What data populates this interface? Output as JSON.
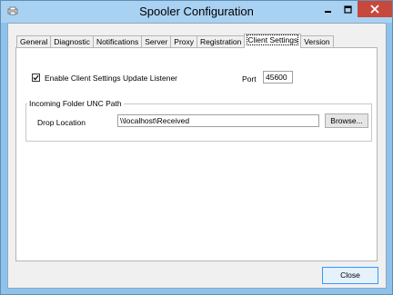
{
  "window": {
    "title": "Spooler Configuration"
  },
  "tabs": [
    {
      "label": "General"
    },
    {
      "label": "Diagnostic"
    },
    {
      "label": "Notifications"
    },
    {
      "label": "Server"
    },
    {
      "label": "Proxy"
    },
    {
      "label": "Registration"
    },
    {
      "label": "Client Settings",
      "active": true
    },
    {
      "label": "Version"
    }
  ],
  "client_settings": {
    "enable_listener_label": "Enable Client Settings Update Listener",
    "enable_listener_checked": true,
    "port_label": "Port",
    "port_value": "45600",
    "group_title": "Incoming Folder UNC Path",
    "drop_location_label": "Drop Location",
    "drop_location_value": "\\\\localhost\\Received",
    "browse_label": "Browse..."
  },
  "footer": {
    "close_label": "Close"
  }
}
